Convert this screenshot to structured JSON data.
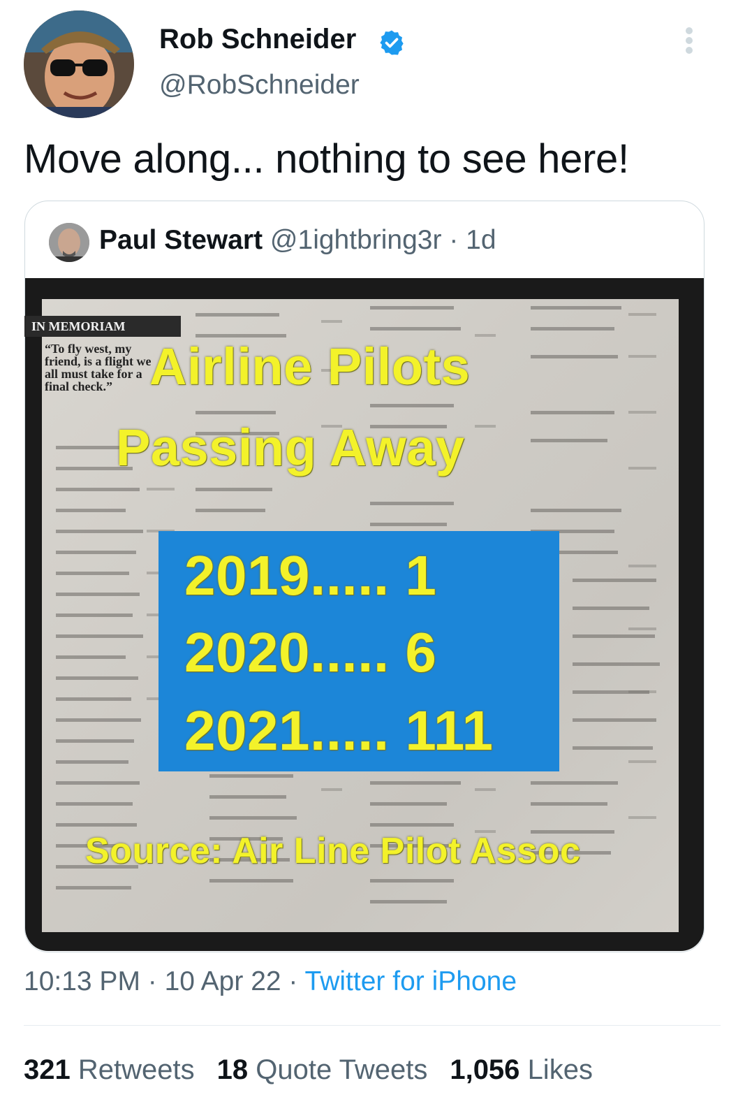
{
  "author": {
    "name": "Rob Schneider",
    "handle": "@RobSchneider",
    "verified_icon": "verified-badge-icon",
    "accent_color": "#1d9bf0"
  },
  "tweet": {
    "text": "Move along... nothing to see here!"
  },
  "quoted_tweet": {
    "name": "Paul Stewart",
    "handle": "@1ightbring3r",
    "age": "· 1d",
    "media": {
      "memoriam_label": "IN MEMORIAM",
      "epitaph": "“To fly west, my friend, is a flight we all must take for a final check.”",
      "headline_line1": "Airline Pilots",
      "headline_line2": "Passing Away",
      "rows": [
        "2019..... 1",
        "2020..... 6",
        "2021..... 111"
      ],
      "source": "Source: Air Line Pilot Assoc",
      "overlay_color": "#f3f22a",
      "box_color": "#1c86d8"
    }
  },
  "meta": {
    "time": "10:13 PM",
    "separator": " · ",
    "date": "10 Apr 22",
    "client": "Twitter for iPhone"
  },
  "stats": {
    "retweets_count": "321",
    "retweets_label": "Retweets",
    "quotes_count": "18",
    "quotes_label": "Quote Tweets",
    "likes_count": "1,056",
    "likes_label": "Likes"
  }
}
